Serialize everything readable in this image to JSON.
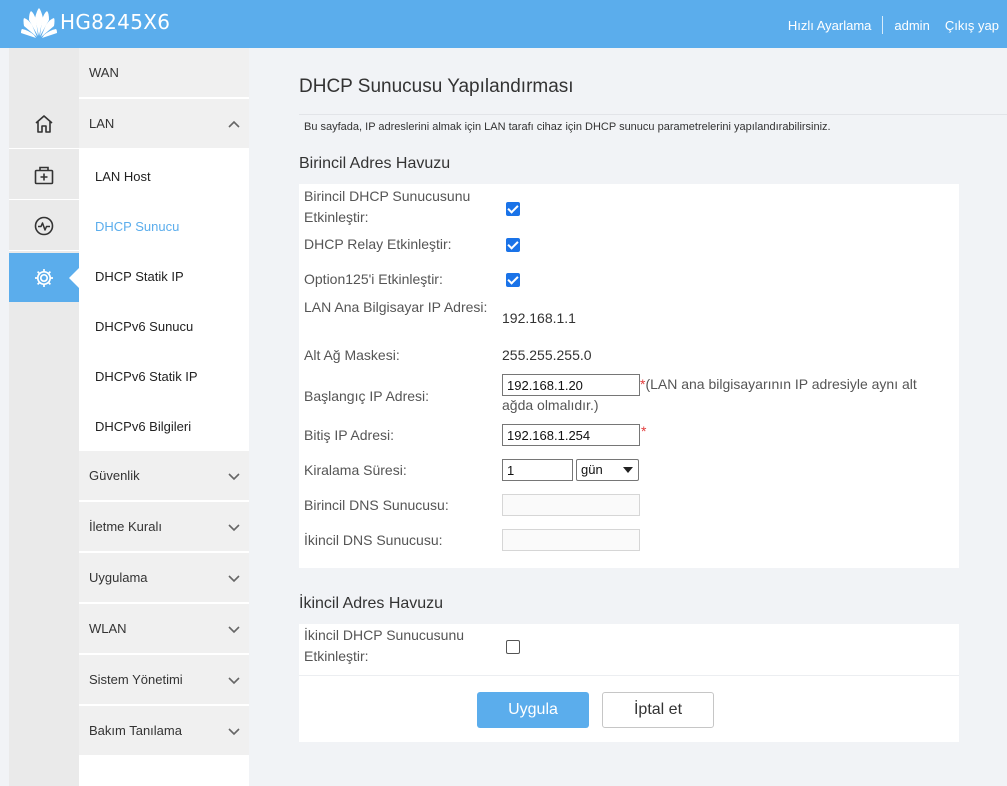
{
  "header": {
    "model": "HG8245X6",
    "quick_setup": "Hızlı Ayarlama",
    "user": "admin",
    "logout": "Çıkış yap",
    "logo_icon": "huawei-logo"
  },
  "rail": {
    "items": [
      {
        "icon": "home-icon"
      },
      {
        "icon": "add-device-icon"
      },
      {
        "icon": "diagnostics-icon"
      },
      {
        "icon": "gear-icon",
        "active": true
      }
    ]
  },
  "menu": {
    "wan": "WAN",
    "lan": "LAN",
    "lan_sub": [
      "LAN Host",
      "DHCP Sunucu",
      "DHCP Statik IP",
      "DHCPv6 Sunucu",
      "DHCPv6 Statik IP",
      "DHCPv6 Bilgileri"
    ],
    "active_sub": "DHCP Sunucu",
    "others": [
      "Güvenlik",
      "İletme Kuralı",
      "Uygulama",
      "WLAN",
      "Sistem Yönetimi",
      "Bakım Tanılama"
    ]
  },
  "page": {
    "title": "DHCP Sunucusu Yapılandırması",
    "description": "Bu sayfada, IP adreslerini almak için LAN tarafı cihaz için DHCP sunucu parametrelerini yapılandırabilirsiniz."
  },
  "primary": {
    "section_title": "Birincil Adres Havuzu",
    "enable_label": "Birincil DHCP Sunucusunu Etkinleştir:",
    "enable_checked": true,
    "relay_label": "DHCP Relay Etkinleştir:",
    "relay_checked": true,
    "option125_label": "Option125'i Etkinleştir:",
    "option125_checked": true,
    "lan_ip_label": "LAN Ana Bilgisayar IP Adresi:",
    "lan_ip": "192.168.1.1",
    "mask_label": "Alt Ağ Maskesi:",
    "mask": "255.255.255.0",
    "start_label": "Başlangıç IP Adresi:",
    "start_value": "192.168.1.20",
    "start_note": "(LAN ana bilgisayarının IP adresiyle aynı alt ağda olmalıdır.)",
    "end_label": "Bitiş IP Adresi:",
    "end_value": "192.168.1.254",
    "required_mark": "*",
    "lease_label": "Kiralama Süresi:",
    "lease_value": "1",
    "lease_unit": "gün",
    "dns1_label": "Birincil DNS Sunucusu:",
    "dns1_value": "",
    "dns2_label": "İkincil DNS Sunucusu:",
    "dns2_value": ""
  },
  "secondary": {
    "section_title": "İkincil Adres Havuzu",
    "enable_label": "İkincil DHCP Sunucusunu Etkinleştir:",
    "enable_checked": false
  },
  "buttons": {
    "apply": "Uygula",
    "cancel": "İptal et"
  },
  "colors": {
    "accent": "#5badec",
    "required": "#e23b3b",
    "checkbox": "#1a73e8"
  }
}
